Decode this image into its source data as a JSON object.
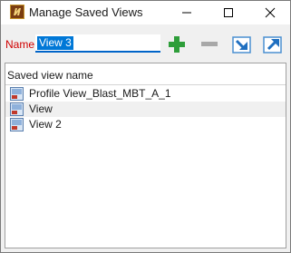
{
  "window": {
    "title": "Manage Saved Views"
  },
  "form": {
    "name_label": "Name",
    "name_value": "View 3"
  },
  "toolbar": {
    "add_icon": "plus-icon",
    "remove_icon": "minus-icon",
    "import_icon": "arrow-down-right-icon",
    "export_icon": "arrow-up-right-icon"
  },
  "list": {
    "header": "Saved view name",
    "items": [
      {
        "label": "Profile View_Blast_MBT_A_1"
      },
      {
        "label": "View"
      },
      {
        "label": "View 2"
      }
    ]
  },
  "colors": {
    "accent": "#0078d7",
    "label_red": "#d00000",
    "add_green": "#2e9e3a"
  }
}
